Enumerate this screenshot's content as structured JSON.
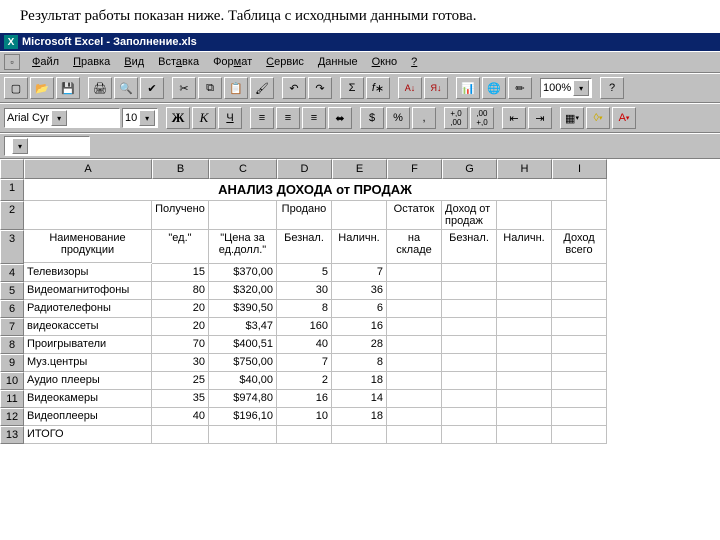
{
  "caption": "Результат работы показан ниже. Таблица с исходными данными готова.",
  "title": "Microsoft Excel - Заполнение.xls",
  "menu": [
    "Файл",
    "Правка",
    "Вид",
    "Вставка",
    "Формат",
    "Сервис",
    "Данные",
    "Окно",
    "?"
  ],
  "zoom": "100%",
  "font": {
    "name": "Arial Cyr",
    "size": "10"
  },
  "fmtlabels": {
    "bold": "Ж",
    "italic": "К",
    "underline": "Ч",
    "percent": "%",
    "comma": ",",
    "dec_inc": "+,0",
    ".dec_dec": "-,0"
  },
  "cols": [
    "A",
    "B",
    "C",
    "D",
    "E",
    "F",
    "G",
    "H",
    "I"
  ],
  "rows": [
    "1",
    "2",
    "3",
    "4",
    "5",
    "6",
    "7",
    "8",
    "9",
    "10",
    "11",
    "12",
    "13"
  ],
  "chart_data": {
    "type": "table",
    "title": "АНАЛИЗ ДОХОДА от ПРОДАЖ",
    "header2": {
      "B": "Получено",
      "D": "Продано",
      "F": "Остаток",
      "G": "Доход от продаж"
    },
    "header3": {
      "A": "Наименование продукции",
      "B": "\"ед.\"",
      "C": "\"Цена за ед.долл.\"",
      "D": "Безнал.",
      "E": "Наличн.",
      "F": "на складе",
      "G": "Безнал.",
      "H": "Наличн.",
      "I": "Доход всего"
    },
    "data": [
      {
        "A": "Телевизоры",
        "B": 15,
        "C": "$370,00",
        "D": 5,
        "E": 7
      },
      {
        "A": "Видеомагнитофоны",
        "B": 80,
        "C": "$320,00",
        "D": 30,
        "E": 36
      },
      {
        "A": "Радиотелефоны",
        "B": 20,
        "C": "$390,50",
        "D": 8,
        "E": 6
      },
      {
        "A": "видеокассеты",
        "B": 20,
        "C": "$3,47",
        "D": 160,
        "E": 16
      },
      {
        "A": "Проигрыватели",
        "B": 70,
        "C": "$400,51",
        "D": 40,
        "E": 28
      },
      {
        "A": "Муз.центры",
        "B": 30,
        "C": "$750,00",
        "D": 7,
        "E": 8
      },
      {
        "A": "Аудио плееры",
        "B": 25,
        "C": "$40,00",
        "D": 2,
        "E": 18
      },
      {
        "A": "Видеокамеры",
        "B": 35,
        "C": "$974,80",
        "D": 16,
        "E": 14
      },
      {
        "A": "Видеоплееры",
        "B": 40,
        "C": "$196,10",
        "D": 10,
        "E": 18
      },
      {
        "A": "ИТОГО"
      }
    ]
  }
}
